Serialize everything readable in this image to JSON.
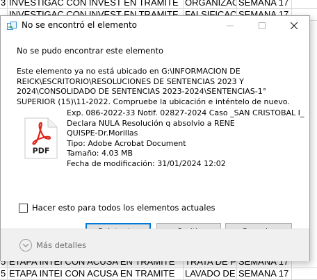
{
  "sheet": {
    "rows": [
      {
        "c0": "3",
        "c1": "INVESTIGAC CON INVEST EN TRAMITE",
        "c2": "ORGANIZACI",
        "c3": "SEMANA 17",
        "c4": ""
      },
      {
        "c0": "",
        "c1": "INVESTIGAC CON INVEST EN TRAMITE",
        "c2": "FALSIFICACI",
        "c3": "SEMANA 17",
        "c4": ""
      },
      {
        "c0": "5",
        "c1": "ETAPA INTEI CON ACUSA EN TRAMITE",
        "c2": "TRATA DE P",
        "c3": "SEMANA 17",
        "c4": ""
      },
      {
        "c0": "5",
        "c1": "ETAPA INTEI CON ACUSA EN TRAMITE",
        "c2": "LAVADO DE",
        "c3": "SEMANA 17",
        "c4": ""
      }
    ]
  },
  "dialog": {
    "title": "No se encontró el elemento",
    "heading": "No se pudo encontrar este elemento",
    "description_lines": [
      "Este elemento ya no está ubicado en G:\\INFORMACION DE",
      "REICK\\ESCRITORIO\\RESOLUCIONES DE SENTENCIAS 2023 Y",
      "2024\\CONSOLIDADO DE SENTENCIAS 2023-2024\\SENTENCIAS-1°",
      "SUPERIOR (15)\\11-2022. Compruebe la ubicación e inténtelo de nuevo."
    ],
    "file": {
      "name_lines": [
        "Exp. 086-2022-33 Notif. 02827-2024 Caso _SAN CRISTOBAL I_",
        "Declara NULA Resolución q absolvio a RENE",
        "QUISPE-Dr.Morillas"
      ],
      "type": "Tipo: Adobe Acrobat Document",
      "size": "Tamaño: 4.03 MB",
      "modified": "Fecha de modificación: 31/01/2024 12:02",
      "icon_label": "PDF",
      "icon": "pdf-file-icon"
    },
    "checkbox_label": "Hacer esto para todos los elementos actuales",
    "checkbox_checked": false,
    "buttons": {
      "retry": "Reintentar",
      "skip": "Omitir",
      "cancel": "Cancelar"
    },
    "more_details": "Más detalles"
  },
  "colors": {
    "focus_border": "#0078d7",
    "pdf_red": "#e2231a"
  }
}
